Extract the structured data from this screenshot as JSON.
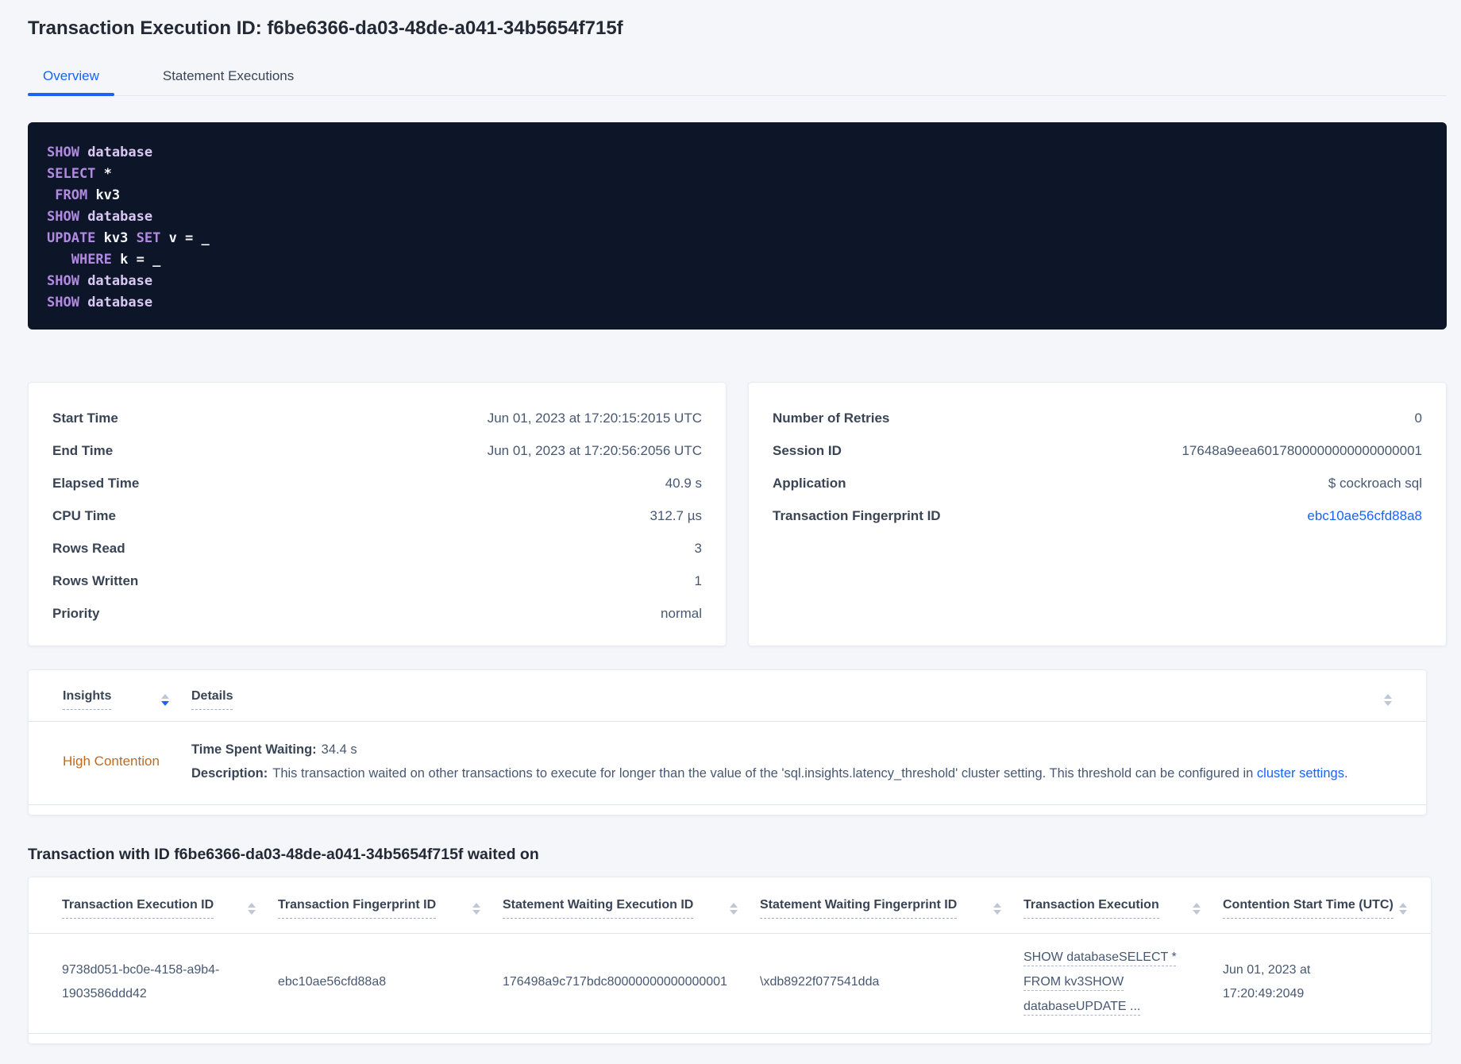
{
  "page": {
    "title": "Transaction Execution ID: f6be6366-da03-48de-a041-34b5654f715f",
    "tabs": [
      {
        "label": "Overview",
        "active": true
      },
      {
        "label": "Statement Executions",
        "active": false
      }
    ]
  },
  "colors": {
    "accent_blue": "#1a63f6",
    "insight_orange": "#c06a1f",
    "code_background": "#0d1628",
    "code_keyword": "#b28ae2",
    "code_text": "#f7f6fb"
  },
  "icons": {
    "sort": "▲▼"
  },
  "sql": {
    "lines": [
      [
        "SHOW",
        " database"
      ],
      [
        "SELECT",
        " *"
      ],
      [
        " ",
        "FROM",
        " kv3"
      ],
      [
        "SHOW",
        " database"
      ],
      [
        "UPDATE",
        " kv3",
        " SET",
        " v = _"
      ],
      [
        "   ",
        "WHERE",
        " k = _"
      ],
      [
        "SHOW",
        " database"
      ],
      [
        "SHOW",
        " database"
      ]
    ]
  },
  "stats_left": [
    {
      "label": "Start Time",
      "value": "Jun 01, 2023 at 17:20:15:2015 UTC"
    },
    {
      "label": "End Time",
      "value": "Jun 01, 2023 at 17:20:56:2056 UTC"
    },
    {
      "label": "Elapsed Time",
      "value": "40.9 s"
    },
    {
      "label": "CPU Time",
      "value": "312.7 µs"
    },
    {
      "label": "Rows Read",
      "value": "3"
    },
    {
      "label": "Rows Written",
      "value": "1"
    },
    {
      "label": "Priority",
      "value": "normal"
    }
  ],
  "stats_right": [
    {
      "label": "Number of Retries",
      "value": "0"
    },
    {
      "label": "Session ID",
      "value": "17648a9eea6017800000000000000001"
    },
    {
      "label": "Application",
      "value": "$ cockroach sql"
    },
    {
      "label": "Transaction Fingerprint ID",
      "value": "ebc10ae56cfd88a8"
    }
  ],
  "insights": {
    "header_insights": "Insights",
    "header_details": "Details",
    "row": {
      "insight": "High Contention",
      "waiting_label": "Time Spent Waiting:",
      "waiting_value": "34.4 s",
      "description_label": "Description:",
      "description_text": "This transaction waited on other transactions to execute for longer than the value of the 'sql.insights.latency_threshold' cluster setting. This threshold can be configured in",
      "description_link": "cluster settings",
      "description_suffix": "."
    }
  },
  "waited": {
    "heading": "Transaction with ID f6be6366-da03-48de-a041-34b5654f715f waited on",
    "columns": [
      "Transaction Execution ID",
      "Transaction Fingerprint ID",
      "Statement Waiting Execution ID",
      "Statement Waiting Fingerprint ID",
      "Transaction Execution",
      "Contention Start Time (UTC)"
    ],
    "row": {
      "transaction_execution_id": "9738d051-bc0e-4158-a9b4-1903586ddd42",
      "transaction_fingerprint_id": "ebc10ae56cfd88a8",
      "statement_waiting_execution_id": "176498a9c717bdc80000000000000001",
      "statement_waiting_fingerprint_id": "\\xdb8922f077541dda",
      "transaction_execution": "SHOW databaseSELECT * FROM kv3SHOW databaseUPDATE ...",
      "contention_start_time": "Jun 01, 2023 at 17:20:49:2049"
    }
  }
}
